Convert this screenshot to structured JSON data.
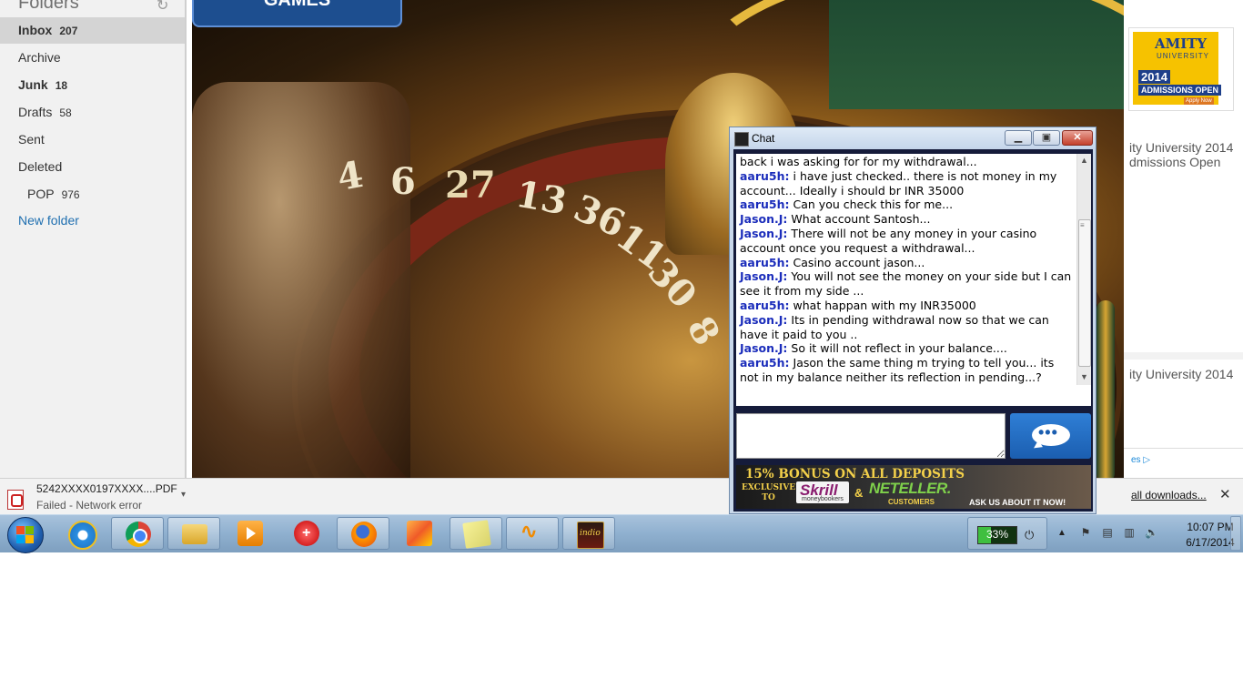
{
  "mail": {
    "title": "Folders",
    "refresh_icon": "refresh-icon",
    "folders": [
      {
        "name": "Inbox",
        "count": "207"
      },
      {
        "name": "Archive",
        "count": ""
      },
      {
        "name": "Junk",
        "count": "18"
      },
      {
        "name": "Drafts",
        "count": "58"
      },
      {
        "name": "Sent",
        "count": ""
      },
      {
        "name": "Deleted",
        "count": ""
      },
      {
        "name": "POP",
        "count": "976"
      }
    ],
    "new_folder": "New folder"
  },
  "game": {
    "tab_label": "GAMES",
    "wheel_numbers": [
      "4",
      "6",
      "27",
      "13",
      "36",
      "11",
      "30",
      "8"
    ]
  },
  "chat": {
    "title": "Chat",
    "messages": [
      {
        "sender": "",
        "text": "back i was asking for for my withdrawal..."
      },
      {
        "sender": "aaru5h:",
        "text": "i have just checked.. there is not money in my account... Ideally i should br INR 35000"
      },
      {
        "sender": "aaru5h:",
        "text": "Can you check this for me..."
      },
      {
        "sender": "Jason.J:",
        "text": "What account Santosh..."
      },
      {
        "sender": "Jason.J:",
        "text": "There will not be any money in your casino account once you request a withdrawal..."
      },
      {
        "sender": "aaru5h:",
        "text": "Casino account jason..."
      },
      {
        "sender": "Jason.J:",
        "text": "You will not see the money on your side but I can see it from my side ..."
      },
      {
        "sender": "aaru5h:",
        "text": "what happan with my INR35000"
      },
      {
        "sender": "Jason.J:",
        "text": "Its in pending withdrawal now so that we can have it paid to you .."
      },
      {
        "sender": "Jason.J:",
        "text": "So it will not reflect in your balance...."
      },
      {
        "sender": "aaru5h:",
        "text": "Jason the same thing m trying to tell you... its not in my balance neither its reflection in pending...?"
      }
    ],
    "input_value": "",
    "banner": {
      "bonus": "15% BONUS ON ALL DEPOSITS",
      "exclusive_line1": "EXCLUSIVE",
      "exclusive_line2": "TO",
      "skrill": "Skrill",
      "skrill_sub": "moneybookers",
      "amp": "&",
      "neteller": "NETELLER.",
      "customers": "CUSTOMERS",
      "ask": "ASK US ABOUT IT NOW!"
    }
  },
  "web": {
    "ad": {
      "name": "AMITY",
      "sub": "UNIVERSITY",
      "year": "2014",
      "admissions": "ADMISSIONS OPEN",
      "apply": "Apply Now"
    },
    "text1_line1": "ity University 2014",
    "text1_line2": "dmissions Open",
    "text2": "ity University 2014"
  },
  "downloads": {
    "file_name": "5242XXXX0197XXXX....PDF",
    "status": "Failed - Network error",
    "show_all": "all downloads...",
    "close_icon": "close-icon"
  },
  "taskbar": {
    "battery_percent": 33,
    "battery_label": "33%",
    "time": "10:07 PM",
    "date": "6/17/2014",
    "apps": [
      "internet-explorer",
      "chrome",
      "file-explorer",
      "media-player",
      "app-red",
      "firefox",
      "photo-app",
      "sticky-notes",
      "winamp",
      "indio-casino"
    ]
  },
  "colors": {
    "sender": "#1b2dbb",
    "taskbar": "#8fb0cf",
    "chat_frame": "#151b3a",
    "send_button": "#2f7fd6"
  }
}
